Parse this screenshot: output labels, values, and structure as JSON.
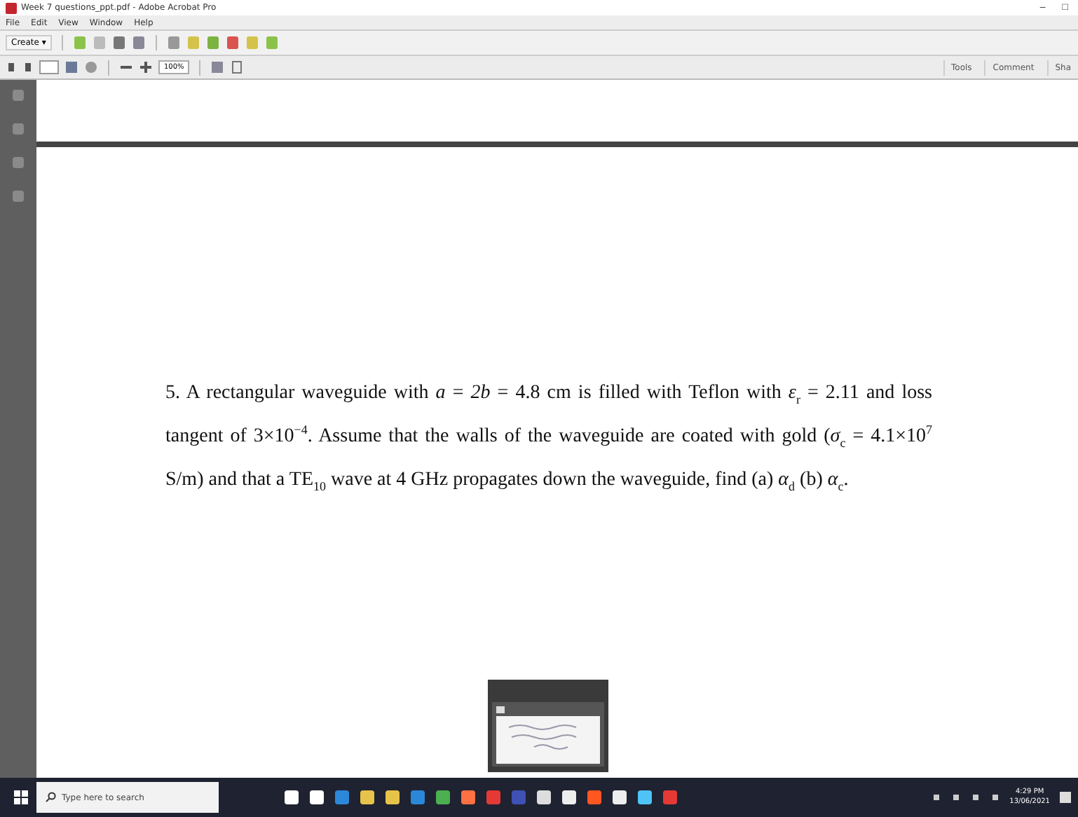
{
  "window": {
    "title": "Week 7 questions_ppt.pdf - Adobe Acrobat Pro",
    "controls": [
      "–",
      "□"
    ]
  },
  "menu": [
    "File",
    "Edit",
    "View",
    "Window",
    "Help"
  ],
  "toolbar": {
    "create": "Create ▾"
  },
  "nav_toolbar": {
    "zoom": "100%",
    "panes": [
      {
        "label": "Tools",
        "selected": false
      },
      {
        "label": "Comment",
        "selected": false
      },
      {
        "label": "Sha",
        "selected": false
      }
    ]
  },
  "document": {
    "paragraphs": [
      "5. A rectangular waveguide with *a* = *2b* = 4.8 cm is filled with Teflon with *ε*$_{r}$ = 2.11 and loss tangent of 3×10$^{−4}$. Assume that the walls of the waveguide are coated with gold (*σ*$_{c}$ = 4.1×10$^{7}$ S/m) and that a TE$_{10}$ wave at 4 GHz propagates down the waveguide, find (a) *α*$_{d}$ (b) *α*$_{c}$."
    ]
  },
  "taskbar": {
    "search": {
      "placeholder": "Type here to search"
    },
    "time": "4:29 PM",
    "date": "13/06/2021"
  }
}
